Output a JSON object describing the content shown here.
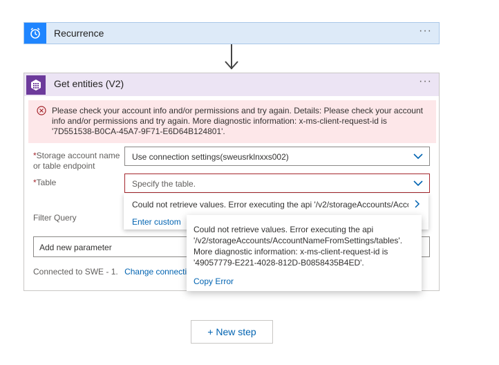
{
  "recurrence": {
    "title": "Recurrence",
    "more": "···"
  },
  "entities": {
    "title": "Get entities (V2)",
    "more": "···",
    "error": "Please check your account info and/or permissions and try again. Details: Please check your account info and/or permissions and try again. More diagnostic information: x-ms-client-request-id is '7D551538-B0CA-45A7-9F71-E6D64B124801'.",
    "fields": {
      "storage_label_1": "Storage account name",
      "storage_label_2": "or table endpoint",
      "storage_value": "Use connection settings(sweusrklnxxs002)",
      "table_label": "Table",
      "table_placeholder": "Specify the table.",
      "filter_label": "Filter Query",
      "required_mark": "*"
    },
    "add_param": "Add new parameter",
    "connected_text": "Connected to SWE - 1.",
    "change_connection": "Change connection."
  },
  "dropdown": {
    "option_error": "Could not retrieve values. Error executing the api '/v2/storageAccounts/AccountNameFromSettings/tables'.",
    "custom_value": "Enter custom value"
  },
  "tooltip": {
    "text": "Could not retrieve values. Error executing the api '/v2/storageAccounts/AccountNameFromSettings/tables'. More diagnostic information: x-ms-client-request-id is '49057779-E221-4028-812D-B0858435B4ED'.",
    "copy": "Copy Error"
  },
  "new_step": "+ New step",
  "colors": {
    "accent": "#0063b1",
    "error": "#a4262c",
    "recurrence": "#1f85ff",
    "table_icon": "#6c3a9b"
  }
}
